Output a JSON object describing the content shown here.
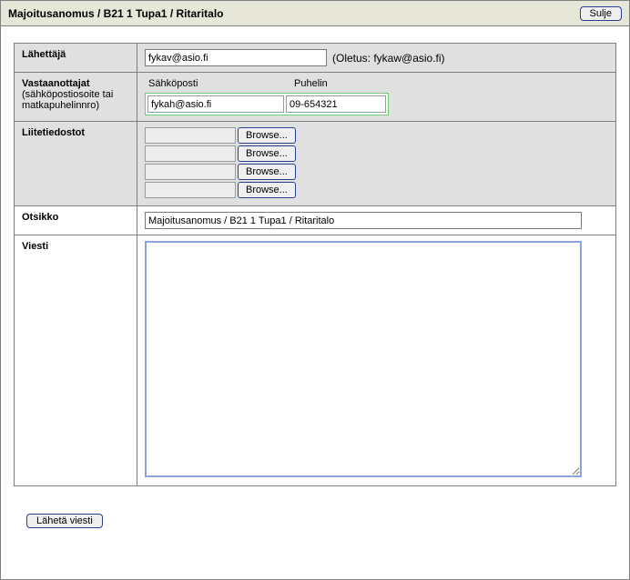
{
  "titlebar": {
    "title": "Majoitusanomus / B21 1 Tupa1 / Ritaritalo",
    "close": "Sulje"
  },
  "labels": {
    "sender": "Lähettäjä",
    "recipients": "Vastaanottajat",
    "recipients_sub": "(sähköpostiosoite tai matkapuhelinnro)",
    "attachments": "Liitetiedostot",
    "subject": "Otsikko",
    "message": "Viesti"
  },
  "sender": {
    "value": "fykav@asio.fi",
    "default_note": "(Oletus: fykaw@asio.fi)"
  },
  "recipients": {
    "email_header": "Sähköposti",
    "phone_header": "Puhelin",
    "email_value": "fykah@asio.fi",
    "phone_value": "09-654321"
  },
  "attachments": {
    "browse_label": "Browse...",
    "rows": [
      "",
      "",
      "",
      ""
    ]
  },
  "subject": {
    "value": "Majoitusanomus / B21 1 Tupa1 / Ritaritalo"
  },
  "message": {
    "value": ""
  },
  "actions": {
    "send": "Lähetä viesti"
  }
}
